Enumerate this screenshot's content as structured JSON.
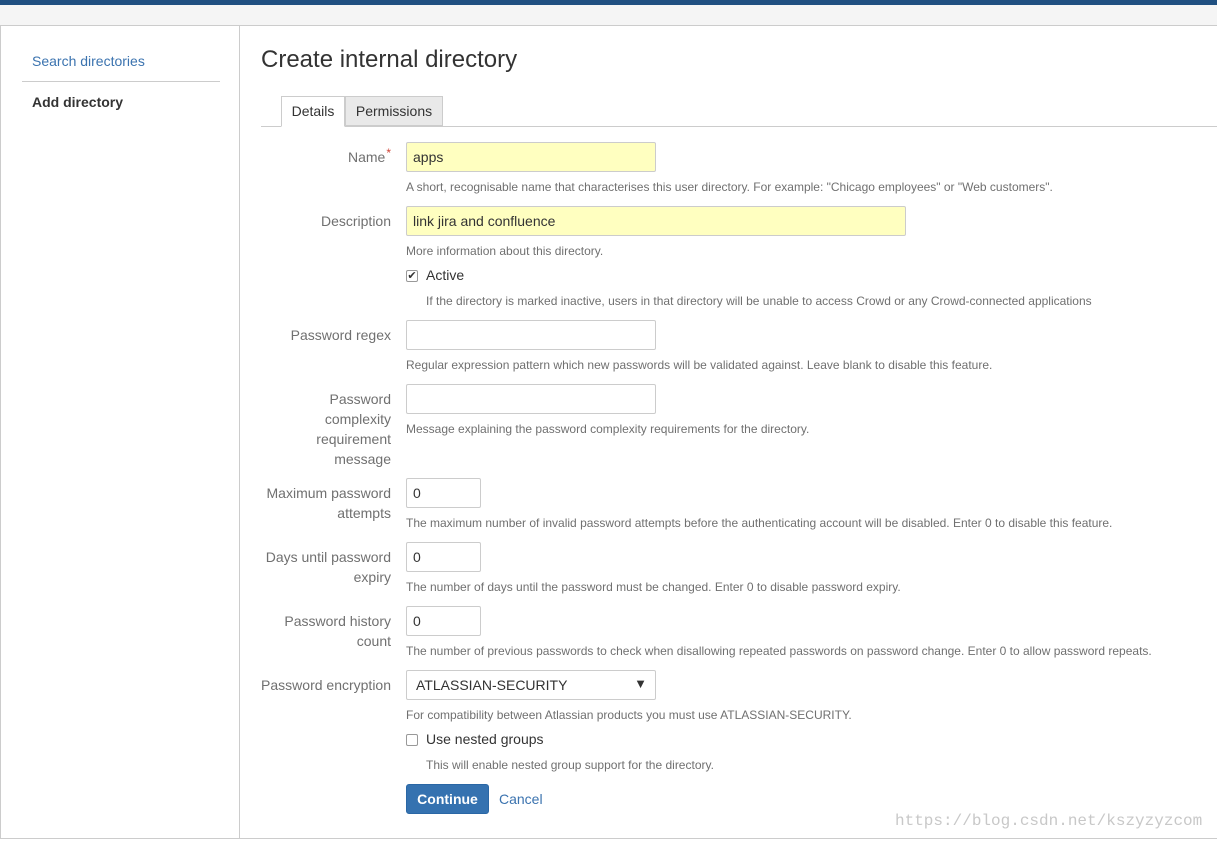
{
  "sidebar": {
    "search_label": "Search directories",
    "add_label": "Add directory"
  },
  "page": {
    "title": "Create internal directory"
  },
  "tabs": [
    {
      "label": "Details",
      "active": true
    },
    {
      "label": "Permissions",
      "active": false
    }
  ],
  "form": {
    "name": {
      "label": "Name",
      "required_marker": "*",
      "value": "apps",
      "help": "A short, recognisable name that characterises this user directory. For example: \"Chicago employees\" or \"Web customers\"."
    },
    "description": {
      "label": "Description",
      "value": "link jira and confluence",
      "help": "More information about this directory."
    },
    "active": {
      "label": "Active",
      "checked": true,
      "help": "If the directory is marked inactive, users in that directory will be unable to access Crowd or any Crowd-connected applications"
    },
    "password_regex": {
      "label": "Password regex",
      "value": "",
      "help": "Regular expression pattern which new passwords will be validated against. Leave blank to disable this feature."
    },
    "complexity_message": {
      "label_lines": [
        "Password",
        "complexity",
        "requirement",
        "message"
      ],
      "value": "",
      "help": "Message explaining the password complexity requirements for the directory."
    },
    "max_attempts": {
      "label_lines": [
        "Maximum password",
        "attempts"
      ],
      "value": "0",
      "help": "The maximum number of invalid password attempts before the authenticating account will be disabled. Enter 0 to disable this feature."
    },
    "days_expiry": {
      "label_lines": [
        "Days until password",
        "expiry"
      ],
      "value": "0",
      "help": "The number of days until the password must be changed. Enter 0 to disable password expiry."
    },
    "history_count": {
      "label_lines": [
        "Password history",
        "count"
      ],
      "value": "0",
      "help": "The number of previous passwords to check when disallowing repeated passwords on password change. Enter 0 to allow password repeats."
    },
    "encryption": {
      "label": "Password encryption",
      "selected": "ATLASSIAN-SECURITY",
      "help": "For compatibility between Atlassian products you must use ATLASSIAN-SECURITY."
    },
    "nested_groups": {
      "label": "Use nested groups",
      "checked": false,
      "help": "This will enable nested group support for the directory."
    }
  },
  "buttons": {
    "continue": "Continue",
    "cancel": "Cancel"
  },
  "watermark": "https://blog.csdn.net/kszyzyzcom",
  "colors": {
    "brand_bar": "#205081",
    "link": "#3b73af",
    "primary_button": "#3572b0",
    "autofill_input": "#ffffc0",
    "required": "#d04437"
  }
}
